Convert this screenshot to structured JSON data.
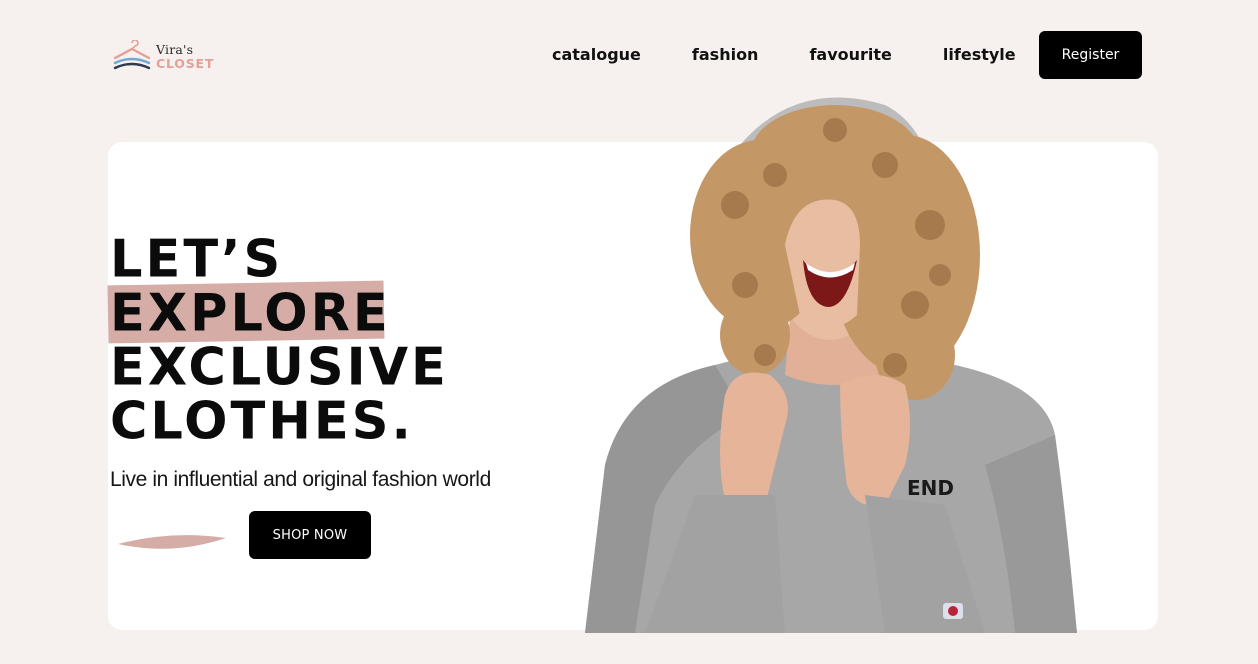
{
  "brand": {
    "line1": "Vira's",
    "line2": "CLOSET",
    "accent_color": "#e3a196"
  },
  "nav": {
    "items": [
      {
        "label": "catalogue"
      },
      {
        "label": "fashion"
      },
      {
        "label": "favourite"
      },
      {
        "label": "lifestyle"
      }
    ],
    "register_label": "Register"
  },
  "hero": {
    "headline": {
      "line1": "LET’S",
      "line2": "EXPLORE",
      "line3": "EXCLUSIVE",
      "line4": "CLOTHES."
    },
    "highlight_color": "#d5aca6",
    "subtitle": "Live in influential and original fashion world",
    "cta_label": "SHOP NOW",
    "image": {
      "icon": "model-photo",
      "sweatshirt_text": "END"
    }
  }
}
